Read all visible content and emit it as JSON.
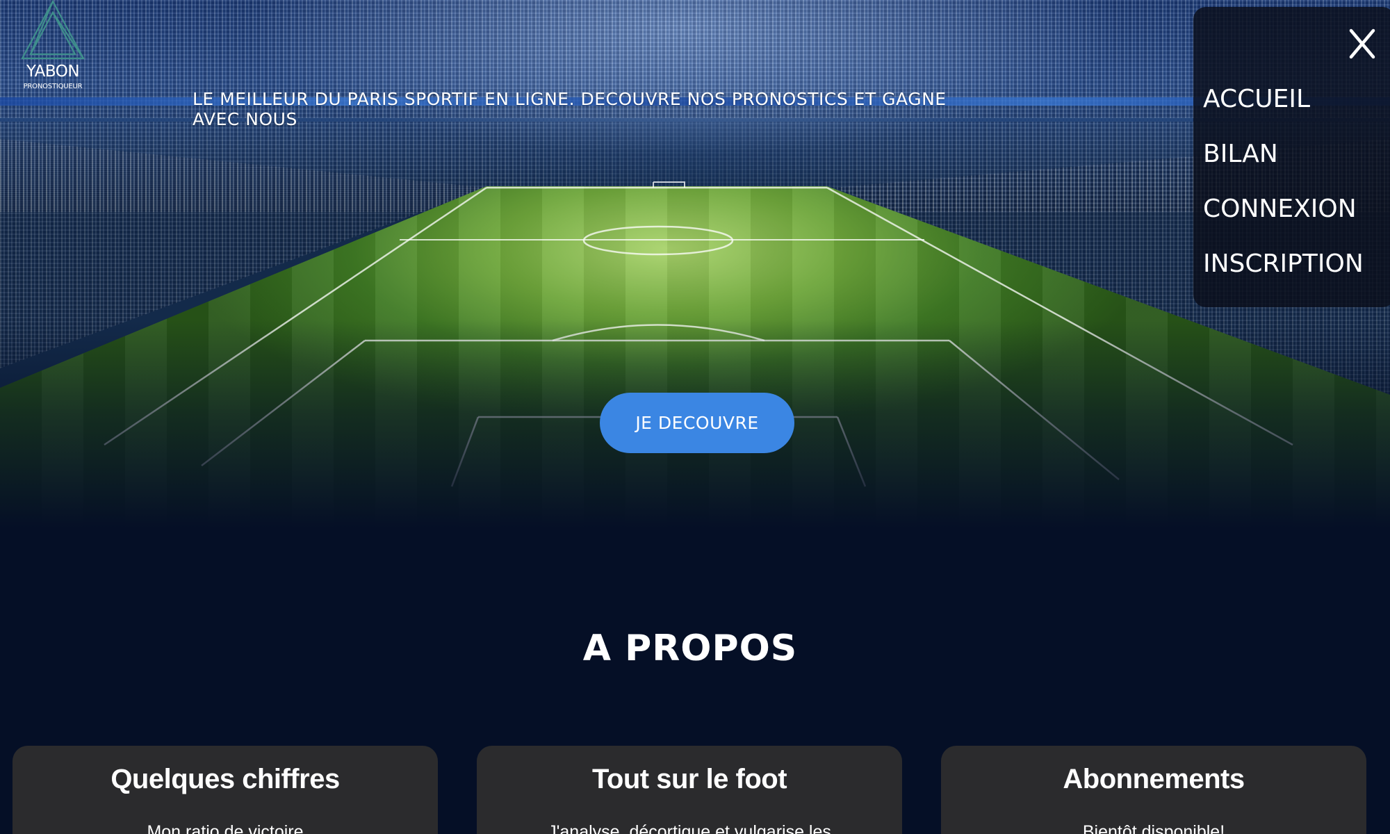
{
  "brand": {
    "name": "YABON",
    "subtitle": "PRONOSTIQUEUR"
  },
  "hero": {
    "tagline": "Le meilleur du paris sportif en ligne. Decouvre nos pronostics et gagne avec nous",
    "cta_label": "Je decouvre"
  },
  "menu": {
    "close_icon": "close-icon",
    "items": [
      {
        "label": "Accueil"
      },
      {
        "label": "Bilan"
      },
      {
        "label": "Connexion"
      },
      {
        "label": "Inscription"
      }
    ]
  },
  "about": {
    "title": "A propos",
    "cards": [
      {
        "title": "Quelques chiffres",
        "text": "Mon ratio de victoire"
      },
      {
        "title": "Tout sur le foot",
        "text": "J'analyse, décortique et vulgarise les"
      },
      {
        "title": "Abonnements",
        "text": "Bientôt disponible!"
      }
    ]
  },
  "colors": {
    "page_background": "#050f26",
    "cta_background": "#3b86e3",
    "card_background": "#2b2b2d",
    "menu_background": "#0a0e1a"
  }
}
